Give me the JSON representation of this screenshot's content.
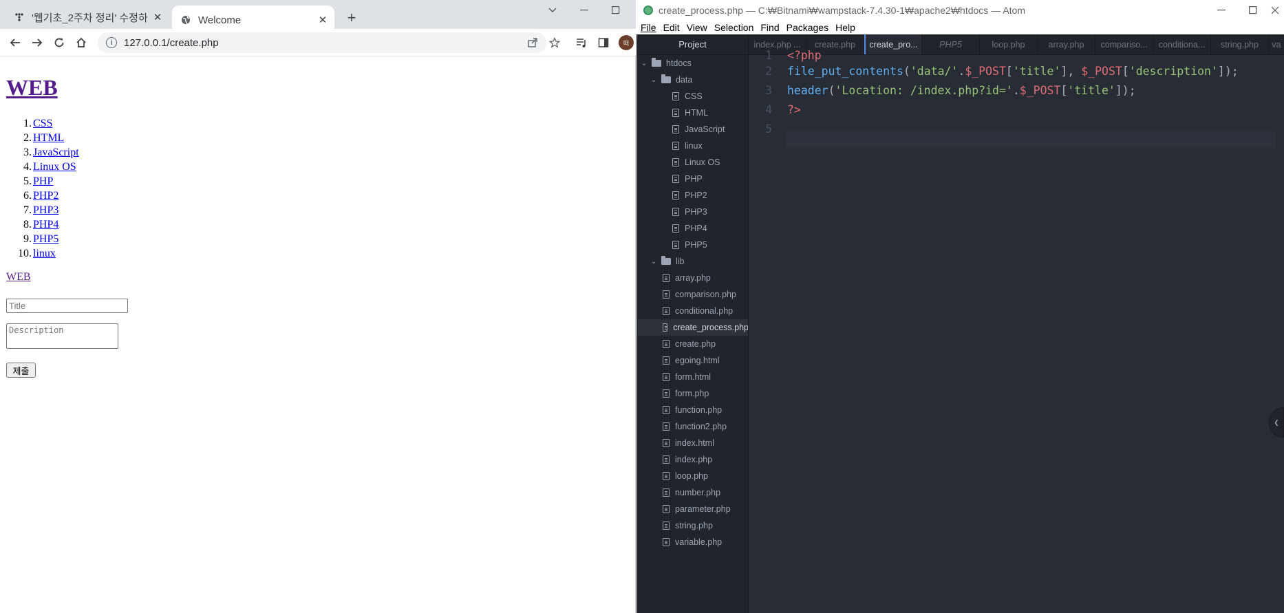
{
  "browser": {
    "tabs": [
      {
        "title": "'웹기초_2주차 정리' 수정하",
        "icon": "notion-icon"
      },
      {
        "title": "Welcome",
        "icon": "globe-icon"
      }
    ],
    "new_tab_label": "+",
    "url": "127.0.0.1/create.php",
    "profile_initial": "떠"
  },
  "page": {
    "heading": "WEB",
    "list": [
      {
        "num": "1.",
        "label": "CSS"
      },
      {
        "num": "2.",
        "label": "HTML"
      },
      {
        "num": "3.",
        "label": "JavaScript"
      },
      {
        "num": "4.",
        "label": "Linux OS"
      },
      {
        "num": "5.",
        "label": "PHP"
      },
      {
        "num": "6.",
        "label": "PHP2"
      },
      {
        "num": "7.",
        "label": "PHP3"
      },
      {
        "num": "8.",
        "label": "PHP4"
      },
      {
        "num": "9.",
        "label": "PHP5"
      },
      {
        "num": "10.",
        "label": "linux"
      }
    ],
    "web_link": "WEB",
    "title_placeholder": "Title",
    "description_placeholder": "Description",
    "submit_label": "제출"
  },
  "atom": {
    "window_title": "create_process.php — C:₩Bitnami₩wampstack-7.4.30-1₩apache2₩htdocs — Atom",
    "menu": [
      "File",
      "Edit",
      "View",
      "Selection",
      "Find",
      "Packages",
      "Help"
    ],
    "tree_header": "Project",
    "tree": [
      {
        "label": "htdocs",
        "kind": "folder",
        "expanded": true
      },
      {
        "label": "data",
        "kind": "folder",
        "expanded": true
      },
      {
        "label": "CSS",
        "kind": "file"
      },
      {
        "label": "HTML",
        "kind": "file"
      },
      {
        "label": "JavaScript",
        "kind": "file"
      },
      {
        "label": "linux",
        "kind": "file"
      },
      {
        "label": "Linux OS",
        "kind": "file"
      },
      {
        "label": "PHP",
        "kind": "file"
      },
      {
        "label": "PHP2",
        "kind": "file"
      },
      {
        "label": "PHP3",
        "kind": "file"
      },
      {
        "label": "PHP4",
        "kind": "file"
      },
      {
        "label": "PHP5",
        "kind": "file"
      },
      {
        "label": "lib",
        "kind": "folder",
        "expanded": true
      },
      {
        "label": "array.php",
        "kind": "file"
      },
      {
        "label": "comparison.php",
        "kind": "file"
      },
      {
        "label": "conditional.php",
        "kind": "file"
      },
      {
        "label": "create_process.php",
        "kind": "file",
        "selected": true
      },
      {
        "label": "create.php",
        "kind": "file"
      },
      {
        "label": "egoing.html",
        "kind": "file"
      },
      {
        "label": "form.html",
        "kind": "file"
      },
      {
        "label": "form.php",
        "kind": "file"
      },
      {
        "label": "function.php",
        "kind": "file"
      },
      {
        "label": "function2.php",
        "kind": "file"
      },
      {
        "label": "index.html",
        "kind": "file"
      },
      {
        "label": "index.php",
        "kind": "file"
      },
      {
        "label": "loop.php",
        "kind": "file"
      },
      {
        "label": "number.php",
        "kind": "file"
      },
      {
        "label": "parameter.php",
        "kind": "file"
      },
      {
        "label": "string.php",
        "kind": "file"
      },
      {
        "label": "variable.php",
        "kind": "file"
      }
    ],
    "tabs": [
      {
        "label": "index.php ...",
        "state": "normal"
      },
      {
        "label": "create.php",
        "state": "normal"
      },
      {
        "label": "create_pro...",
        "state": "active"
      },
      {
        "label": "PHP5",
        "state": "preview"
      },
      {
        "label": "loop.php",
        "state": "normal"
      },
      {
        "label": "array.php",
        "state": "normal"
      },
      {
        "label": "compariso...",
        "state": "normal"
      },
      {
        "label": "conditiona...",
        "state": "normal"
      },
      {
        "label": "string.php",
        "state": "normal"
      },
      {
        "label": "va",
        "state": "normal"
      }
    ],
    "line_numbers": [
      "1",
      "2",
      "3",
      "4",
      "5"
    ],
    "code": {
      "l1_open": "<?php",
      "l2_fn": "file_put_contents",
      "l2_p1": "(",
      "l2_s1": "'data/'",
      "l2_p2": ".",
      "l2_v1": "$_POST",
      "l2_p3": "[",
      "l2_s2": "'title'",
      "l2_p4": "], ",
      "l2_v2": "$_POST",
      "l2_p5": "[",
      "l2_s3": "'description'",
      "l2_p6": "]);",
      "l3_fn": "header",
      "l3_p1": "(",
      "l3_s1": "'Location: /index.php?id='",
      "l3_p2": ".",
      "l3_v1": "$_POST",
      "l3_p3": "[",
      "l3_s2": "'title'",
      "l3_p4": "]);",
      "l4_close": "?>"
    },
    "colors": {
      "tag": "#e06c75",
      "function": "#61afef",
      "string": "#98c379",
      "bg": "#282c34"
    }
  }
}
